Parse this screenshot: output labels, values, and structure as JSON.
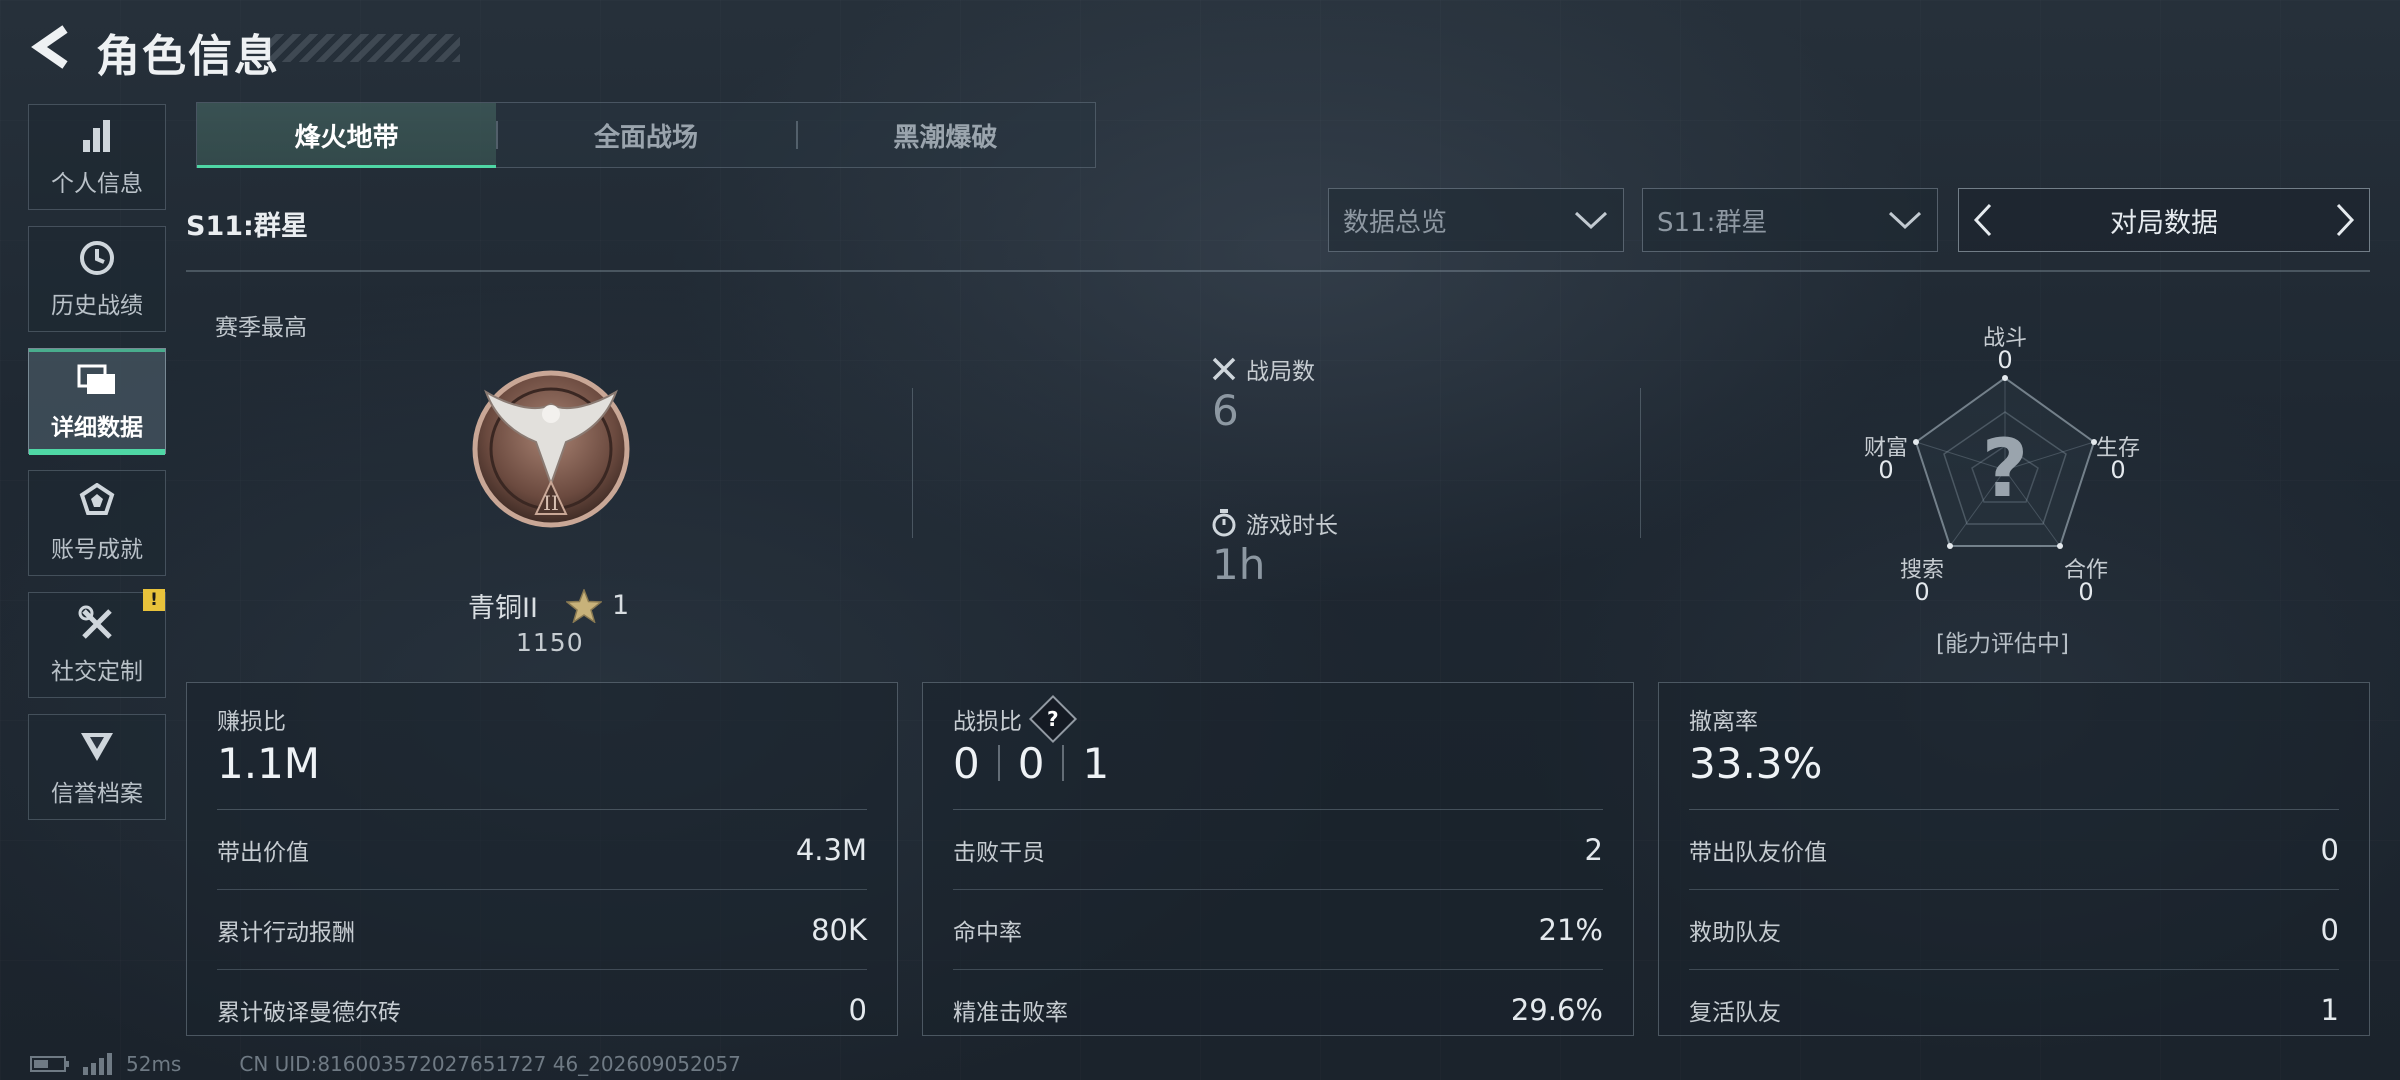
{
  "header": {
    "title": "角色信息",
    "back_icon": "back-arrow-icon"
  },
  "sidebar": {
    "items": [
      {
        "label": "个人信息",
        "icon": "bar-chart-icon",
        "active": false
      },
      {
        "label": "历史战绩",
        "icon": "clock-icon",
        "active": false
      },
      {
        "label": "详细数据",
        "icon": "folders-icon",
        "active": true
      },
      {
        "label": "账号成就",
        "icon": "achievement-icon",
        "active": false
      },
      {
        "label": "社交定制",
        "icon": "tools-icon",
        "active": false,
        "badge": "!"
      },
      {
        "label": "信誉档案",
        "icon": "shield-icon",
        "active": false
      }
    ]
  },
  "tabs": [
    {
      "label": "烽火地带",
      "active": true
    },
    {
      "label": "全面战场",
      "active": false
    },
    {
      "label": "黑潮爆破",
      "active": false
    }
  ],
  "season": {
    "label": "S11:群星",
    "filter_type": "数据总览",
    "filter_season": "S11:群星",
    "pager_label": "对局数据"
  },
  "summary": {
    "season_best_label": "赛季最高",
    "rank_name": "青铜II",
    "rank_stars": "1",
    "rank_score": "1150",
    "medal_numeral": "II",
    "matches_label": "战局数",
    "matches_value": "6",
    "playtime_label": "游戏时长",
    "playtime_value": "1h"
  },
  "radar": {
    "center_mark": "?",
    "axes": [
      {
        "label": "战斗",
        "value": "0"
      },
      {
        "label": "生存",
        "value": "0"
      },
      {
        "label": "合作",
        "value": "0"
      },
      {
        "label": "搜索",
        "value": "0"
      },
      {
        "label": "财富",
        "value": "0"
      }
    ],
    "note": "[能力评估中]"
  },
  "cards": {
    "profit": {
      "title": "赚损比",
      "value": "1.1M",
      "rows": [
        {
          "label": "带出价值",
          "value": "4.3M"
        },
        {
          "label": "累计行动报酬",
          "value": "80K"
        },
        {
          "label": "累计破译曼德尔砖",
          "value": "0"
        }
      ]
    },
    "combat": {
      "title": "战损比",
      "help": "?",
      "kd": [
        "0",
        "0",
        "1"
      ],
      "rows": [
        {
          "label": "击败干员",
          "value": "2"
        },
        {
          "label": "命中率",
          "value": "21%"
        },
        {
          "label": "精准击败率",
          "value": "29.6%"
        }
      ]
    },
    "extract": {
      "title": "撤离率",
      "value": "33.3%",
      "rows": [
        {
          "label": "带出队友价值",
          "value": "0"
        },
        {
          "label": "救助队友",
          "value": "0"
        },
        {
          "label": "复活队友",
          "value": "1"
        }
      ]
    }
  },
  "footer": {
    "ping": "52ms",
    "uid": "CN UID:816003572027651727 46_202609052057"
  },
  "colors": {
    "accent": "#4fd7a5",
    "warn": "#e8c23b"
  }
}
